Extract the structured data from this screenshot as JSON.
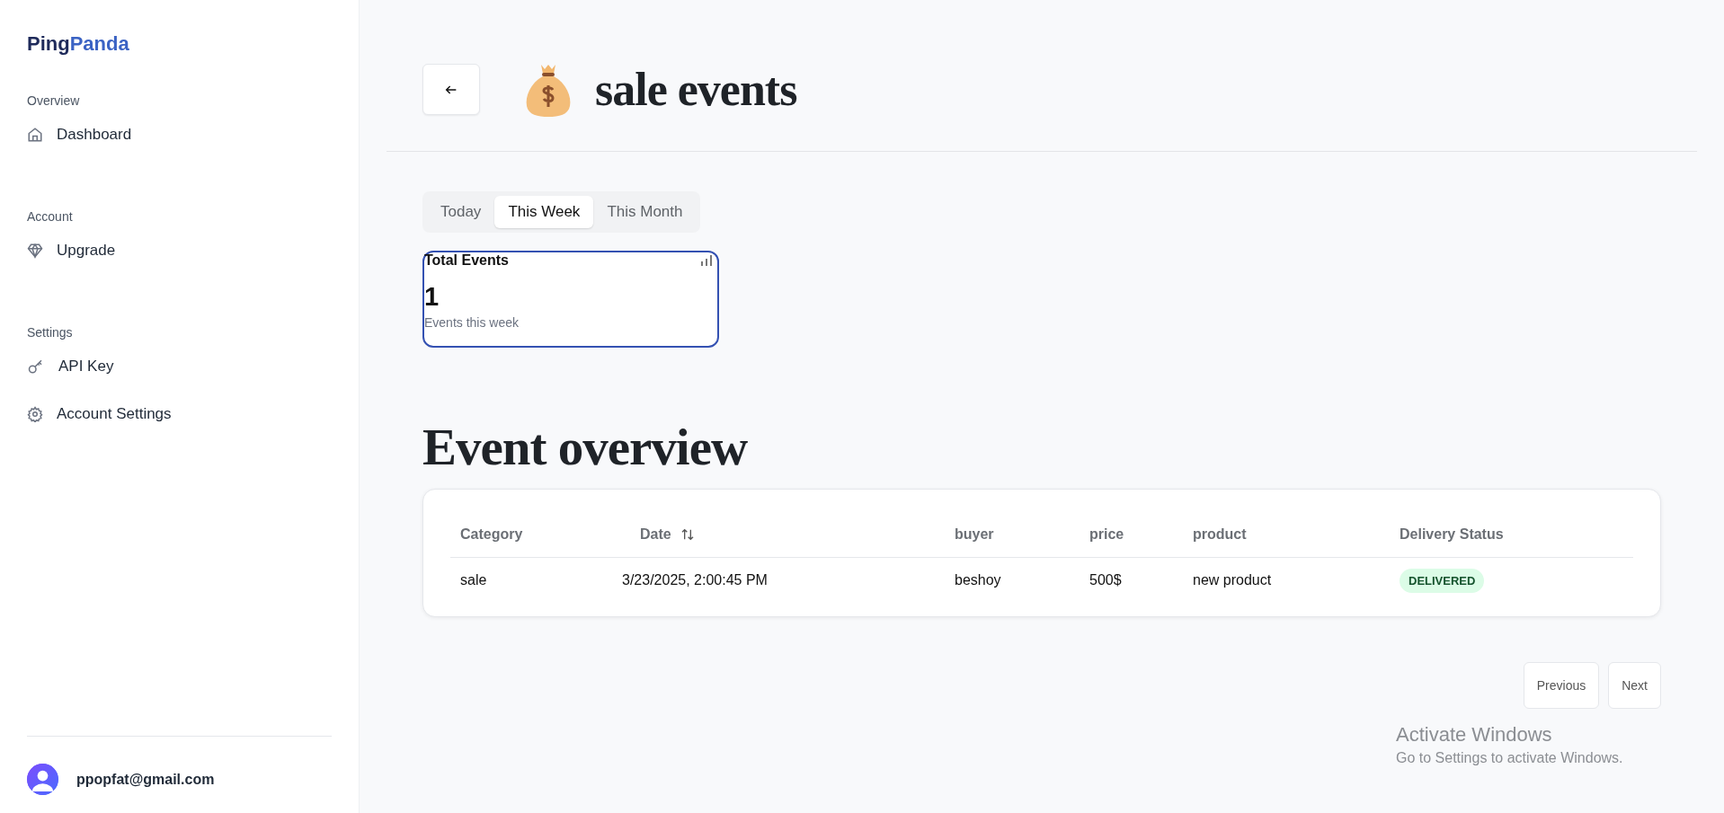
{
  "brand": {
    "first": "Ping",
    "second": "Panda"
  },
  "sidebar": {
    "sections": [
      {
        "heading": "Overview",
        "items": [
          {
            "label": "Dashboard"
          }
        ]
      },
      {
        "heading": "Account",
        "items": [
          {
            "label": "Upgrade"
          }
        ]
      },
      {
        "heading": "Settings",
        "items": [
          {
            "label": "API Key"
          },
          {
            "label": "Account Settings"
          }
        ]
      }
    ],
    "user": {
      "email": "ppopfat@gmail.com"
    }
  },
  "header": {
    "title": "sale events"
  },
  "tabs": [
    {
      "label": "Today",
      "selected": false
    },
    {
      "label": "This Week",
      "selected": true
    },
    {
      "label": "This Month",
      "selected": false
    }
  ],
  "stat_card": {
    "title": "Total Events",
    "value": "1",
    "caption": "Events this week"
  },
  "section_title": "Event overview",
  "table": {
    "columns": [
      {
        "label": "Category",
        "sortable": false
      },
      {
        "label": "Date",
        "sortable": true
      },
      {
        "label": "buyer",
        "sortable": false
      },
      {
        "label": "price",
        "sortable": false
      },
      {
        "label": "product",
        "sortable": false
      },
      {
        "label": "Delivery Status",
        "sortable": false
      }
    ],
    "rows": [
      {
        "cells": [
          "sale",
          "3/23/2025, 2:00:45 PM",
          "beshoy",
          "500$",
          "new product"
        ],
        "status": "DELIVERED"
      }
    ]
  },
  "pagination": {
    "previous": "Previous",
    "next": "Next"
  },
  "os_notice": {
    "title": "Activate Windows",
    "text": "Go to Settings to activate Windows."
  }
}
